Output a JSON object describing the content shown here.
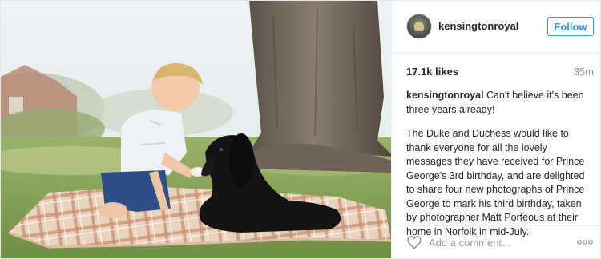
{
  "post": {
    "username": "kensingtonroyal",
    "follow_label": "Follow",
    "likes": "17.1k likes",
    "time_ago": "35m",
    "caption": {
      "username": "kensingtonroyal",
      "first_line": "Can't believe it's been three years already!",
      "body": "The Duke and Duchess would like to thank everyone for all the lovely messages they have received for Prince George's 3rd birthday, and are delighted to share four new photographs of Prince George to mark his third birthday, taken by photographer Matt Porteous at their home in Norfolk in mid-July."
    },
    "comment_placeholder": "Add a comment...",
    "icons": {
      "like": "heart-outline-icon",
      "more": "more-options-icon"
    },
    "colors": {
      "accent": "#3897f0",
      "text": "#262626",
      "muted": "#999999",
      "border": "#efefef"
    }
  }
}
